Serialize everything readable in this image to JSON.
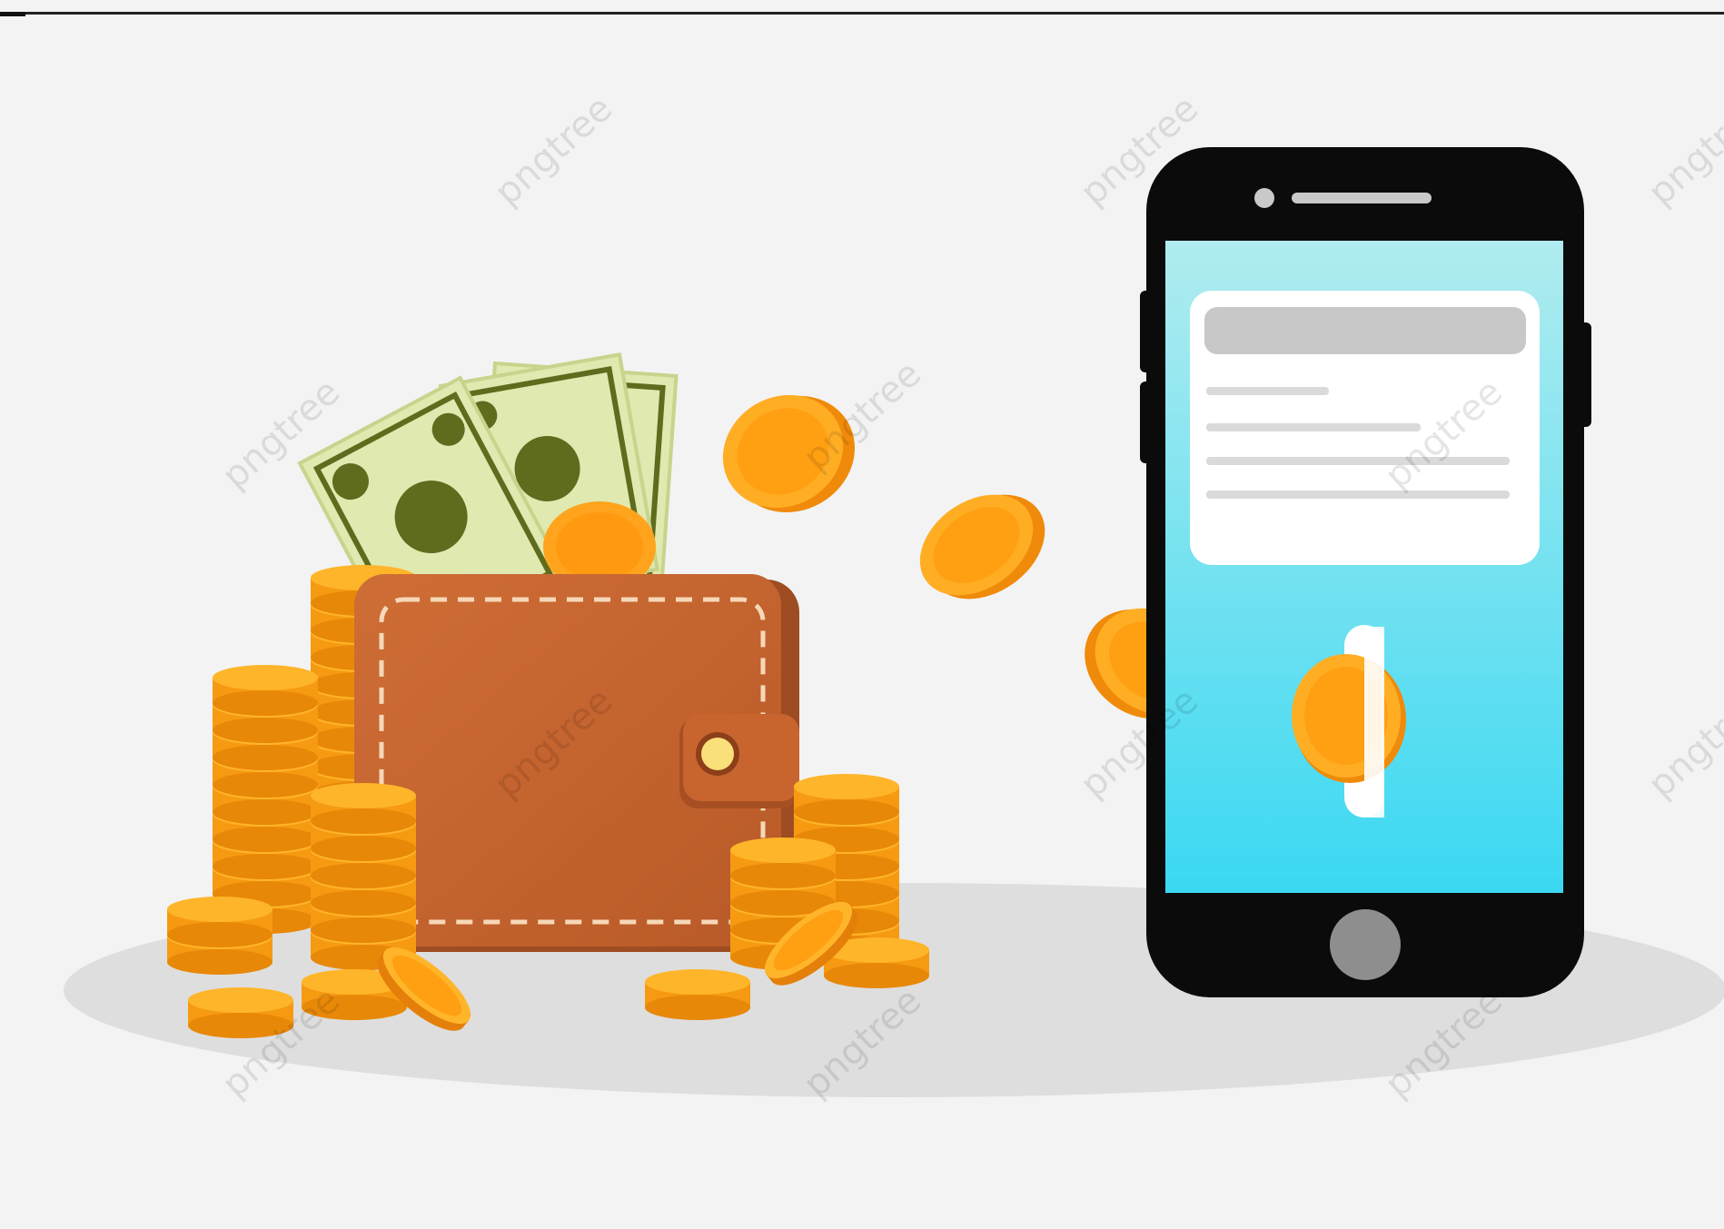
{
  "illustration": {
    "subject": "wallet-to-phone-payment",
    "watermark_text": "pngtree",
    "colors": {
      "background": "#f3f3f3",
      "shadow": "#dedede",
      "top_rule": "#222222",
      "wallet": "#c3632e",
      "wallet_dark": "#9e4c22",
      "stitch": "#f6d8b8",
      "clasp_button": "#f9e07a",
      "banknote": "#dfe9b0",
      "banknote_ink": "#5f6b1d",
      "coin_face": "#ffab1f",
      "coin_rim": "#f28a0c",
      "coin_edge": "#f7a016",
      "phone_body": "#0b0b0b",
      "screen_top": "#b0ecef",
      "screen_bottom": "#3ad8f2",
      "card": "#ffffff",
      "card_bar": "#c8c8c8",
      "card_line": "#dadada",
      "slot": "#ffffff",
      "home_button": "#8e8e8e"
    },
    "icons": [
      "wallet-icon",
      "banknote-icon",
      "coin-icon",
      "smartphone-icon"
    ]
  }
}
